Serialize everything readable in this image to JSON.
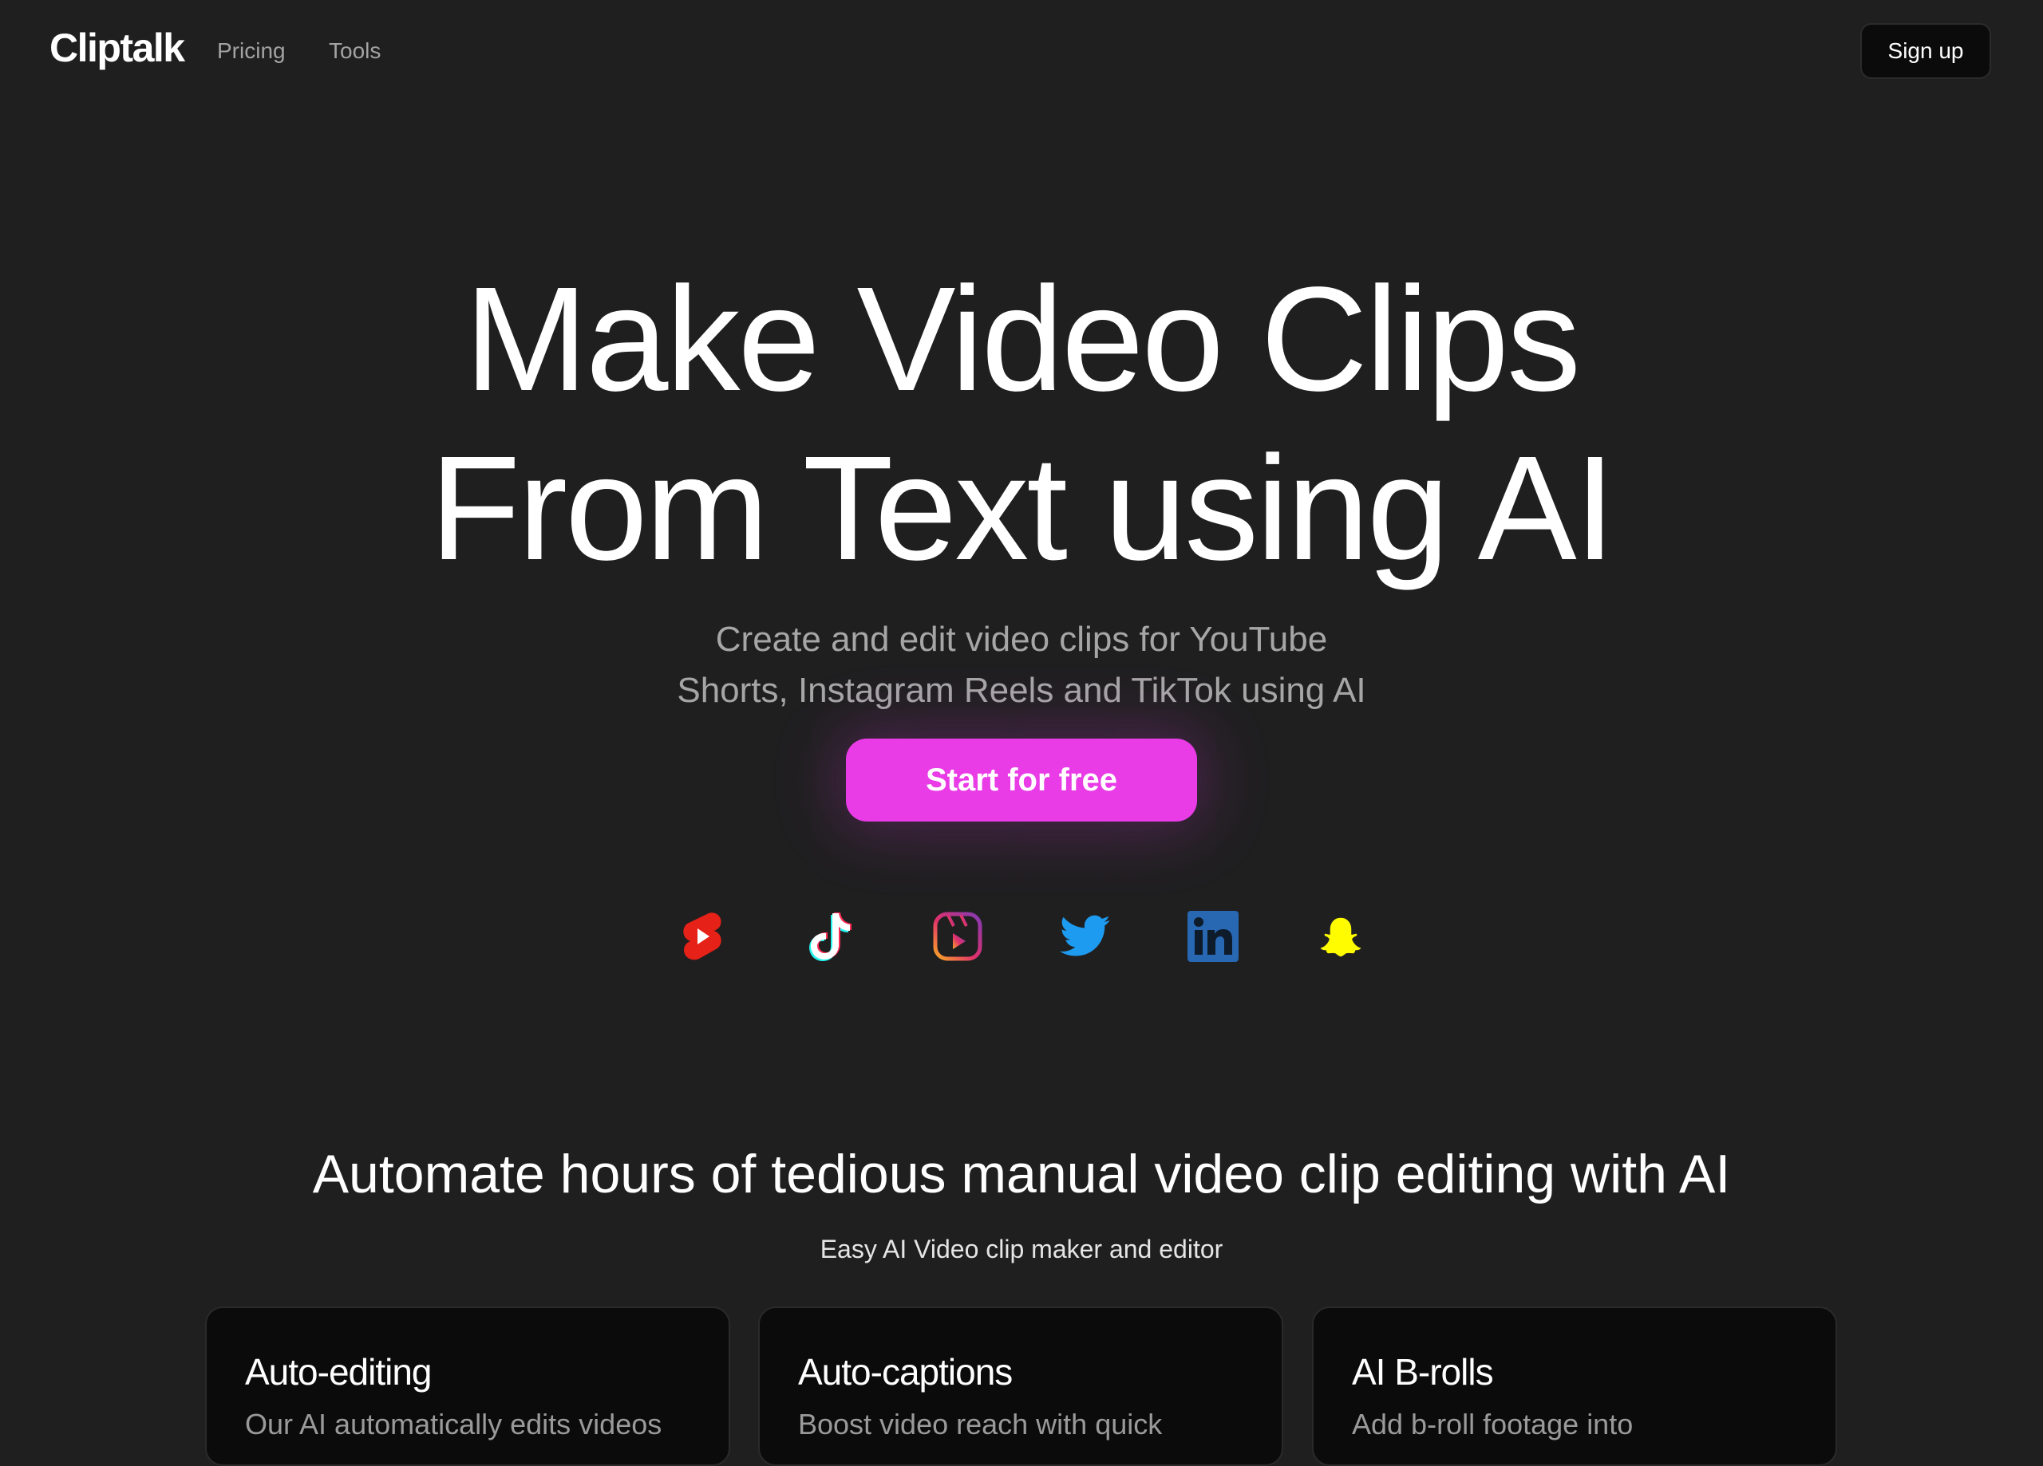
{
  "nav": {
    "brand": "Cliptalk",
    "links": [
      {
        "label": "Pricing"
      },
      {
        "label": "Tools"
      }
    ],
    "signup_label": "Sign up"
  },
  "hero": {
    "title_line1": "Make Video Clips",
    "title_line2": "From Text using AI",
    "subtitle_line1": "Create and edit video clips for YouTube",
    "subtitle_line2": "Shorts, Instagram Reels and TikTok using AI",
    "cta_label": "Start for free",
    "cta_color": "#e93be6"
  },
  "platforms": [
    {
      "icon": "youtube-shorts-icon",
      "color": "#e62117"
    },
    {
      "icon": "tiktok-icon",
      "color": "#ffffff"
    },
    {
      "icon": "instagram-reels-icon",
      "color": "#c13584"
    },
    {
      "icon": "twitter-icon",
      "color": "#1d9bf0"
    },
    {
      "icon": "linkedin-icon",
      "color": "#2867b2"
    },
    {
      "icon": "snapchat-icon",
      "color": "#fffc00"
    }
  ],
  "features": {
    "title": "Automate hours of tedious manual video clip editing with AI",
    "subtitle": "Easy AI Video clip maker and editor",
    "cards": [
      {
        "title": "Auto-editing",
        "desc": "Our AI automatically edits videos"
      },
      {
        "title": "Auto-captions",
        "desc": "Boost video reach with quick"
      },
      {
        "title": "AI B-rolls",
        "desc": "Add b-roll footage into"
      }
    ]
  }
}
